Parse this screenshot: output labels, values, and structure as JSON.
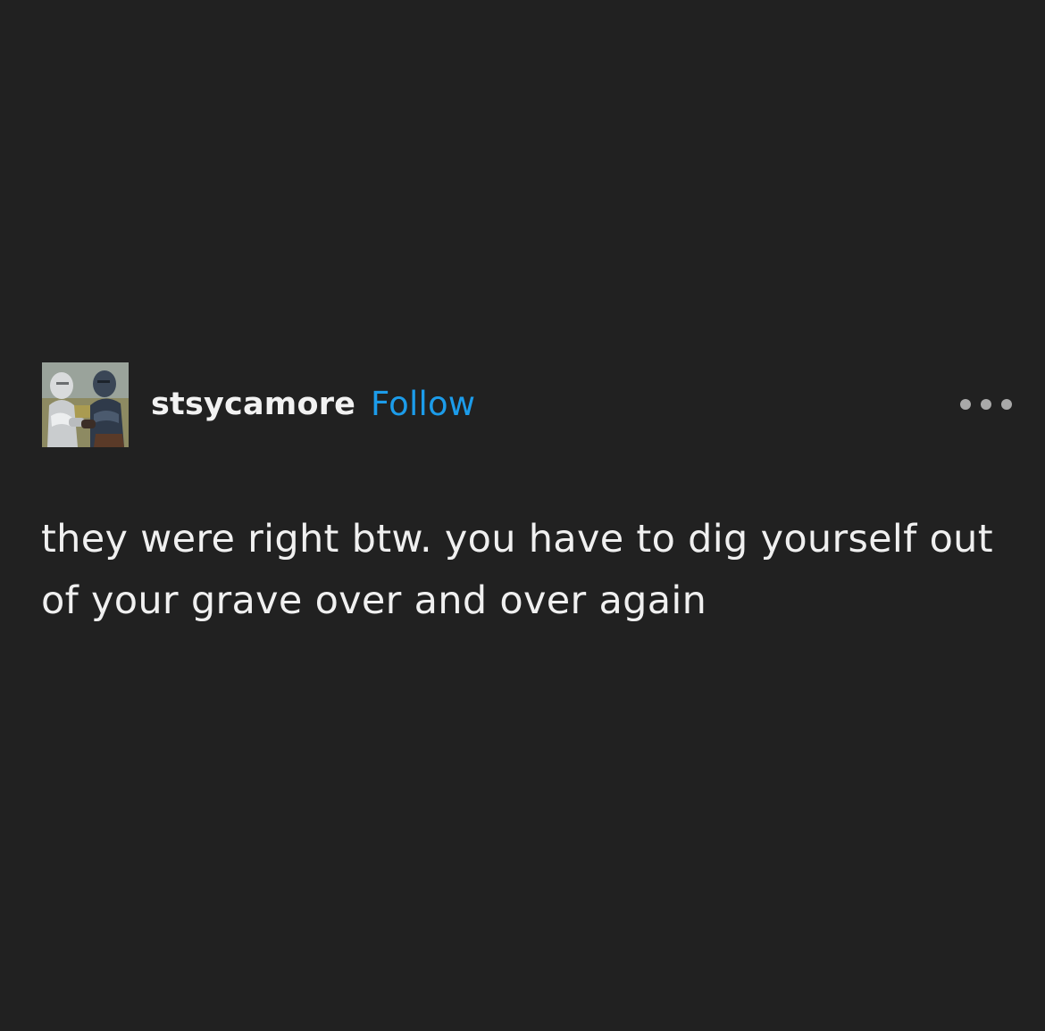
{
  "post": {
    "author": {
      "username": "stsycamore",
      "follow_label": "Follow"
    },
    "menu_icon": "more-horizontal-icon",
    "body_text": "they were right btw. you have to dig yourself out of your grave over and over again"
  },
  "colors": {
    "background": "#212121",
    "text": "#f0f0f0",
    "accent": "#1c9cea",
    "menu_dots": "#a9a9a9"
  }
}
